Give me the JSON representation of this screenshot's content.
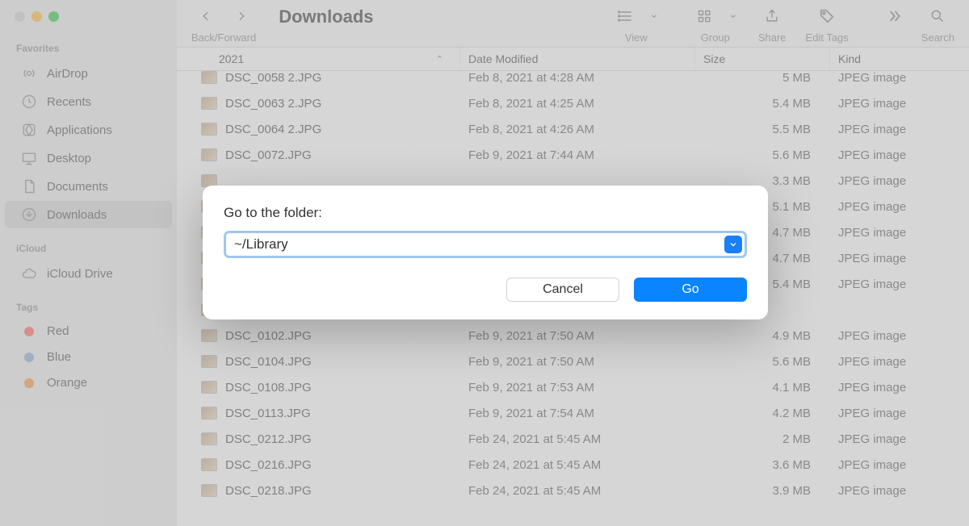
{
  "window": {
    "title": "Downloads"
  },
  "toolbar": {
    "back_forward": "Back/Forward",
    "view": "View",
    "group": "Group",
    "share": "Share",
    "edit_tags": "Edit Tags",
    "search": "Search"
  },
  "sidebar": {
    "favorites_title": "Favorites",
    "icloud_title": "iCloud",
    "tags_title": "Tags",
    "items": [
      {
        "key": "airdrop",
        "label": "AirDrop"
      },
      {
        "key": "recents",
        "label": "Recents"
      },
      {
        "key": "applications",
        "label": "Applications"
      },
      {
        "key": "desktop",
        "label": "Desktop"
      },
      {
        "key": "documents",
        "label": "Documents"
      },
      {
        "key": "downloads",
        "label": "Downloads"
      }
    ],
    "icloud_items": [
      {
        "key": "icloud-drive",
        "label": "iCloud Drive"
      }
    ],
    "tags": [
      {
        "key": "red",
        "label": "Red",
        "color": "#ff5f57"
      },
      {
        "key": "blue",
        "label": "Blue",
        "color": "#3b82f6"
      },
      {
        "key": "orange",
        "label": "Orange",
        "color": "#fb923c"
      }
    ]
  },
  "columns": {
    "name": "2021",
    "date": "Date Modified",
    "size": "Size",
    "kind": "Kind"
  },
  "files": [
    {
      "name": "DSC_0058 2.JPG",
      "date": "Feb 8, 2021 at 4:28 AM",
      "size": "5 MB",
      "kind": "JPEG image"
    },
    {
      "name": "DSC_0063 2.JPG",
      "date": "Feb 8, 2021 at 4:25 AM",
      "size": "5.4 MB",
      "kind": "JPEG image"
    },
    {
      "name": "DSC_0064 2.JPG",
      "date": "Feb 8, 2021 at 4:26 AM",
      "size": "5.5 MB",
      "kind": "JPEG image"
    },
    {
      "name": "DSC_0072.JPG",
      "date": "Feb 9, 2021 at 7:44 AM",
      "size": "5.6 MB",
      "kind": "JPEG image"
    },
    {
      "name": "",
      "date": "",
      "size": "3.3 MB",
      "kind": "JPEG image"
    },
    {
      "name": "",
      "date": "",
      "size": "5.1 MB",
      "kind": "JPEG image"
    },
    {
      "name": "",
      "date": "",
      "size": "4.7 MB",
      "kind": "JPEG image"
    },
    {
      "name": "",
      "date": "",
      "size": "4.7 MB",
      "kind": "JPEG image"
    },
    {
      "name": "",
      "date": "",
      "size": "5.4 MB",
      "kind": "JPEG image"
    },
    {
      "name": "",
      "date": "",
      "size": "",
      "kind": ""
    },
    {
      "name": "DSC_0102.JPG",
      "date": "Feb 9, 2021 at 7:50 AM",
      "size": "4.9 MB",
      "kind": "JPEG image"
    },
    {
      "name": "DSC_0104.JPG",
      "date": "Feb 9, 2021 at 7:50 AM",
      "size": "5.6 MB",
      "kind": "JPEG image"
    },
    {
      "name": "DSC_0108.JPG",
      "date": "Feb 9, 2021 at 7:53 AM",
      "size": "4.1 MB",
      "kind": "JPEG image"
    },
    {
      "name": "DSC_0113.JPG",
      "date": "Feb 9, 2021 at 7:54 AM",
      "size": "4.2 MB",
      "kind": "JPEG image"
    },
    {
      "name": "DSC_0212.JPG",
      "date": "Feb 24, 2021 at 5:45 AM",
      "size": "2 MB",
      "kind": "JPEG image"
    },
    {
      "name": "DSC_0216.JPG",
      "date": "Feb 24, 2021 at 5:45 AM",
      "size": "3.6 MB",
      "kind": "JPEG image"
    },
    {
      "name": "DSC_0218.JPG",
      "date": "Feb 24, 2021 at 5:45 AM",
      "size": "3.9 MB",
      "kind": "JPEG image"
    }
  ],
  "dialog": {
    "label": "Go to the folder:",
    "value": "~/Library",
    "cancel": "Cancel",
    "go": "Go"
  }
}
